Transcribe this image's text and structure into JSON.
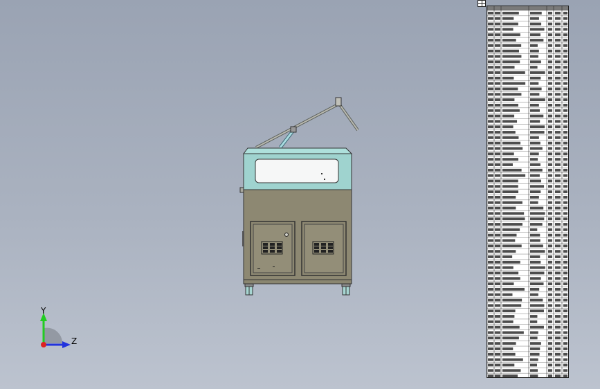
{
  "viewport": {
    "background": "#a5adbb",
    "model": {
      "name": "laser-marking-machine",
      "body_color": "#8d8872",
      "panel_color": "#9ed3cf"
    }
  },
  "triad": {
    "y_label": "Y",
    "z_label": "Z",
    "y_color": "#22cc22",
    "z_color": "#2233dd",
    "origin_color": "#dd2222"
  },
  "bom": {
    "row_count": 68
  }
}
